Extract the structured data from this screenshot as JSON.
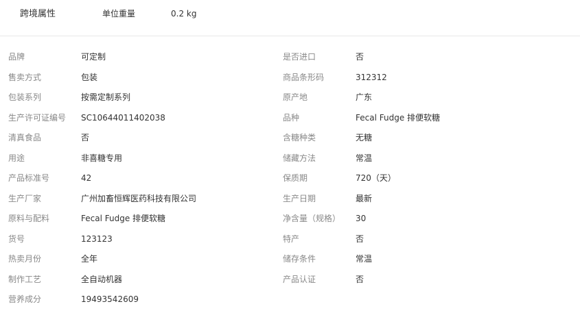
{
  "section": {
    "title": "跨境属性",
    "label": "单位重量",
    "value": "0.2 kg"
  },
  "attributes": [
    {
      "left_label": "品牌",
      "left_value": "可定制",
      "right_label": "是否进口",
      "right_value": "否"
    },
    {
      "left_label": "售卖方式",
      "left_value": "包装",
      "right_label": "商品条形码",
      "right_value": "312312"
    },
    {
      "left_label": "包装系列",
      "left_value": "按需定制系列",
      "right_label": "原产地",
      "right_value": "广东"
    },
    {
      "left_label": "生产许可证编号",
      "left_value": "SC10644011402038",
      "right_label": "品种",
      "right_value": "Fecal Fudge 排便软糖"
    },
    {
      "left_label": "清真食品",
      "left_value": "否",
      "right_label": "含糖种类",
      "right_value": "无糖"
    },
    {
      "left_label": "用途",
      "left_value": "非喜糖专用",
      "right_label": "储藏方法",
      "right_value": "常温"
    },
    {
      "left_label": "产品标准号",
      "left_value": "42",
      "right_label": "保质期",
      "right_value": "720（天）"
    },
    {
      "left_label": "生产厂家",
      "left_value": "广州加畜恒辉医药科技有限公司",
      "right_label": "生产日期",
      "right_value": "最新"
    },
    {
      "left_label": "原料与配料",
      "left_value": "Fecal Fudge 排便软糖",
      "right_label": "净含量（规格）",
      "right_value": "30"
    },
    {
      "left_label": "货号",
      "left_value": "123123",
      "right_label": "特产",
      "right_value": "否"
    },
    {
      "left_label": "热卖月份",
      "left_value": "全年",
      "right_label": "储存条件",
      "right_value": "常温"
    },
    {
      "left_label": "制作工艺",
      "left_value": "全自动机器",
      "right_label": "产品认证",
      "right_value": "否"
    },
    {
      "left_label": "营养成分",
      "left_value": "19493542609"
    }
  ]
}
